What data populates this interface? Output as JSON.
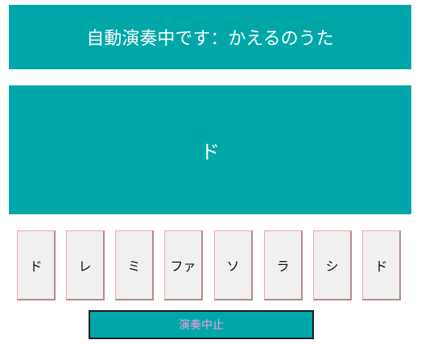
{
  "status": {
    "text": "自動演奏中です：かえるのうた"
  },
  "display": {
    "current_note": "ド"
  },
  "keys": [
    {
      "label": "ド"
    },
    {
      "label": "レ"
    },
    {
      "label": "ミ"
    },
    {
      "label": "ファ"
    },
    {
      "label": "ソ"
    },
    {
      "label": "ラ"
    },
    {
      "label": "シ"
    },
    {
      "label": "ド"
    }
  ],
  "controls": {
    "stop_label": "演奏中止"
  },
  "colors": {
    "panel": "#00a7a9",
    "key_face": "#f0f0f0",
    "key_border": "#f3a6a6",
    "stop_text": "#ff9de0"
  }
}
